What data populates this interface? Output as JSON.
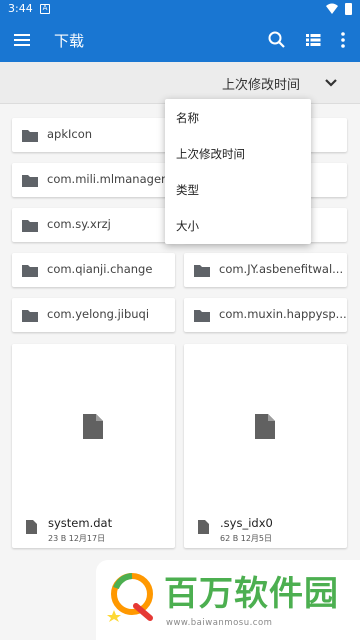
{
  "status": {
    "time": "3:44",
    "sim_glyph": "A"
  },
  "appbar": {
    "title": "下载"
  },
  "sortbar": {
    "current_sort": "上次修改时间"
  },
  "dropdown": {
    "options": [
      "名称",
      "上次修改时间",
      "类型",
      "大小"
    ]
  },
  "folders": {
    "left": [
      "apkIcon",
      "com.mili.mlmanager",
      "com.sy.xrzj",
      "com.qianji.change",
      "com.yelong.jibuqi"
    ],
    "right": [
      "com.JY.asbenefitwal...",
      "com.muxin.happysp..."
    ]
  },
  "files": [
    {
      "name": "system.dat",
      "meta": "23 B 12月17日"
    },
    {
      "name": ".sys_idx0",
      "meta": "62 B 12月5日"
    }
  ],
  "watermark": {
    "text": "百万软件园",
    "url": "www.baiwanmosu.com"
  },
  "colors": {
    "primary": "#1976d2",
    "background": "#f5f5f5",
    "watermark_green": "#4caf50"
  },
  "icons": [
    "hamburger-menu-icon",
    "search-icon",
    "list-view-icon",
    "more-vert-icon",
    "chevron-down-icon",
    "folder-icon",
    "document-icon",
    "wifi-icon",
    "battery-icon"
  ]
}
